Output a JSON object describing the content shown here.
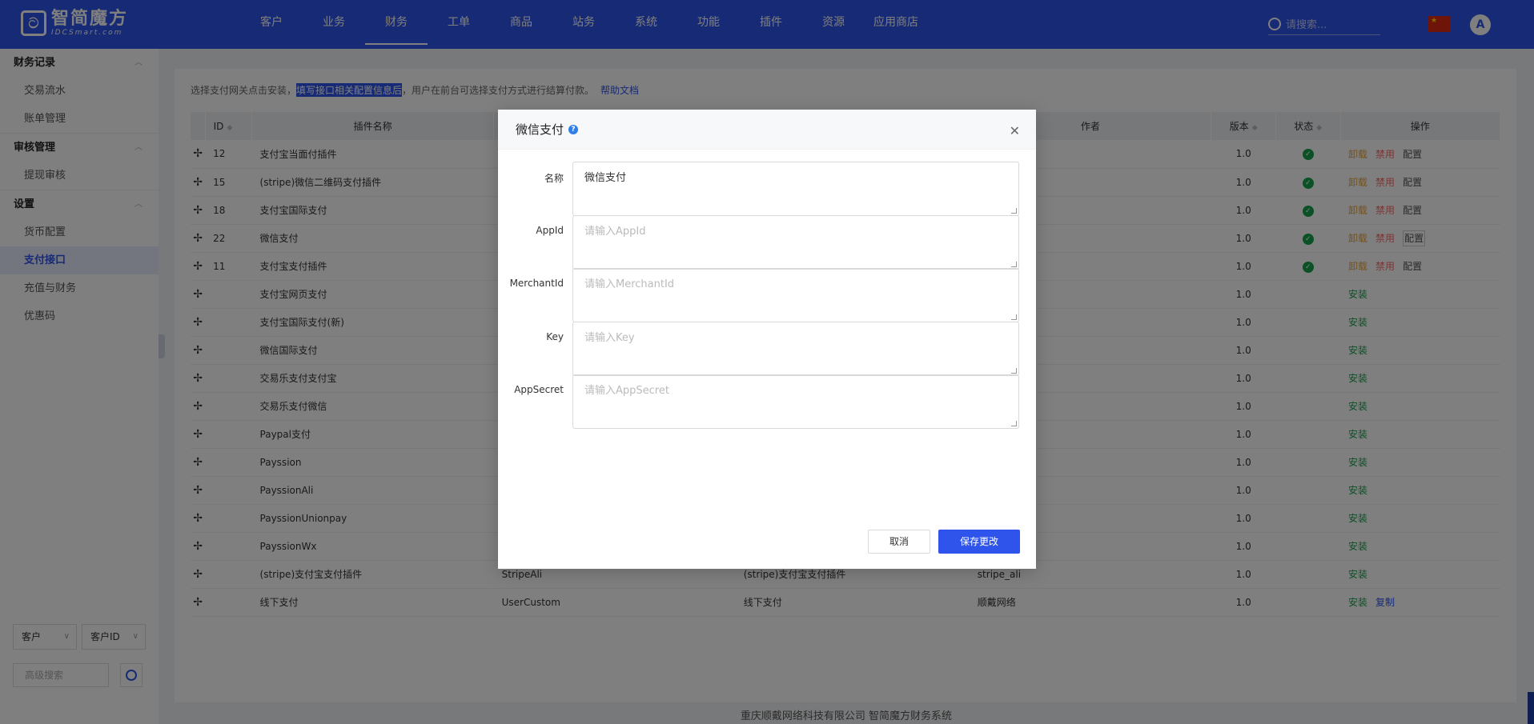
{
  "app": {
    "logo_cn": "智简魔方",
    "logo_en": "IDCSmart.com"
  },
  "nav": {
    "items": [
      "客户",
      "业务",
      "财务",
      "工单",
      "商品",
      "站务",
      "系统",
      "功能",
      "插件",
      "资源",
      "应用商店"
    ],
    "active": "财务",
    "search_placeholder": "请搜索...",
    "avatar_letter": "A"
  },
  "sidebar": {
    "groups": [
      {
        "label": "财务记录",
        "items": [
          "交易流水",
          "账单管理"
        ]
      },
      {
        "label": "审核管理",
        "items": [
          "提现审核"
        ]
      },
      {
        "label": "设置",
        "items": [
          "货币配置",
          "支付接口",
          "充值与财务",
          "优惠码"
        ]
      }
    ],
    "active_item": "支付接口",
    "filter_select_1": "客户",
    "filter_select_2": "客户ID",
    "adv_search_placeholder": "高级搜索"
  },
  "hint": {
    "prefix": "选择支付网关点击安装，",
    "highlight": "填写接口相关配置信息后",
    "suffix": "，用户在前台可选择支付方式进行结算付款。",
    "link": "帮助文档"
  },
  "table": {
    "headers": {
      "id": "ID",
      "name": "插件名称",
      "author": "作者",
      "version": "版本",
      "status": "状态",
      "actions": "操作"
    },
    "rows": [
      {
        "id": "12",
        "name": "支付宝当面付插件",
        "col3": "",
        "col4": "",
        "author": "",
        "version": "1.0",
        "enabled": true,
        "actions": [
          "卸载",
          "禁用",
          "配置"
        ]
      },
      {
        "id": "15",
        "name": "(stripe)微信二维码支付插件",
        "col3": "",
        "col4": "",
        "author": "",
        "version": "1.0",
        "enabled": true,
        "actions": [
          "卸载",
          "禁用",
          "配置"
        ]
      },
      {
        "id": "18",
        "name": "支付宝国际支付",
        "col3": "",
        "col4": "",
        "author": "",
        "version": "1.0",
        "enabled": true,
        "actions": [
          "卸载",
          "禁用",
          "配置"
        ]
      },
      {
        "id": "22",
        "name": "微信支付",
        "col3": "",
        "col4": "",
        "author": "",
        "version": "1.0",
        "enabled": true,
        "actions": [
          "卸载",
          "禁用",
          "配置"
        ]
      },
      {
        "id": "11",
        "name": "支付宝支付插件",
        "col3": "",
        "col4": "",
        "author": "",
        "version": "1.0",
        "enabled": true,
        "actions": [
          "卸载",
          "禁用",
          "配置"
        ]
      },
      {
        "id": "",
        "name": "支付宝网页支付",
        "col3": "",
        "col4": "",
        "author": "",
        "version": "1.0",
        "enabled": false,
        "actions": [
          "安装"
        ]
      },
      {
        "id": "",
        "name": "支付宝国际支付(新)",
        "col3": "",
        "col4": "",
        "author": "",
        "version": "1.0",
        "enabled": false,
        "actions": [
          "安装"
        ]
      },
      {
        "id": "",
        "name": "微信国际支付",
        "col3": "",
        "col4": "",
        "author": "",
        "version": "1.0",
        "enabled": false,
        "actions": [
          "安装"
        ]
      },
      {
        "id": "",
        "name": "交易乐支付支付宝",
        "col3": "",
        "col4": "",
        "author": "",
        "version": "1.0",
        "enabled": false,
        "actions": [
          "安装"
        ]
      },
      {
        "id": "",
        "name": "交易乐支付微信",
        "col3": "",
        "col4": "",
        "author": "",
        "version": "1.0",
        "enabled": false,
        "actions": [
          "安装"
        ]
      },
      {
        "id": "",
        "name": "Paypal支付",
        "col3": "",
        "col4": "",
        "author": "",
        "version": "1.0",
        "enabled": false,
        "actions": [
          "安装"
        ]
      },
      {
        "id": "",
        "name": "Payssion",
        "col3": "",
        "col4": "",
        "author": "",
        "version": "1.0",
        "enabled": false,
        "actions": [
          "安装"
        ]
      },
      {
        "id": "",
        "name": "PayssionAli",
        "col3": "",
        "col4": "",
        "author": "",
        "version": "1.0",
        "enabled": false,
        "actions": [
          "安装"
        ]
      },
      {
        "id": "",
        "name": "PayssionUnionpay",
        "col3": "",
        "col4": "",
        "author": "",
        "version": "1.0",
        "enabled": false,
        "actions": [
          "安装"
        ]
      },
      {
        "id": "",
        "name": "PayssionWx",
        "col3": "",
        "col4": "",
        "author": "",
        "version": "1.0",
        "enabled": false,
        "actions": [
          "安装"
        ]
      },
      {
        "id": "",
        "name": "(stripe)支付宝支付插件",
        "col3": "StripeAli",
        "col4": "(stripe)支付宝支付插件",
        "author": "stripe_ali",
        "version": "1.0",
        "enabled": false,
        "actions": [
          "安装"
        ]
      },
      {
        "id": "",
        "name": "线下支付",
        "col3": "UserCustom",
        "col4": "线下支付",
        "author": "顺戴网络",
        "version": "1.0",
        "enabled": false,
        "actions": [
          "安装",
          "复制"
        ]
      }
    ]
  },
  "footer": "重庆顺戴网络科技有限公司 智简魔方财务系统",
  "modal": {
    "title": "微信支付",
    "fields": [
      {
        "label": "名称",
        "value": "微信支付",
        "placeholder": ""
      },
      {
        "label": "AppId",
        "value": "",
        "placeholder": "请输入AppId"
      },
      {
        "label": "MerchantId",
        "value": "",
        "placeholder": "请输入MerchantId"
      },
      {
        "label": "Key",
        "value": "",
        "placeholder": "请输入Key"
      },
      {
        "label": "AppSecret",
        "value": "",
        "placeholder": "请输入AppSecret"
      }
    ],
    "cancel": "取消",
    "save": "保存更改"
  },
  "colors": {
    "primary": "#2f54eb",
    "success": "#17a34a",
    "warning": "#e6a23c",
    "danger": "#f56c6c"
  }
}
